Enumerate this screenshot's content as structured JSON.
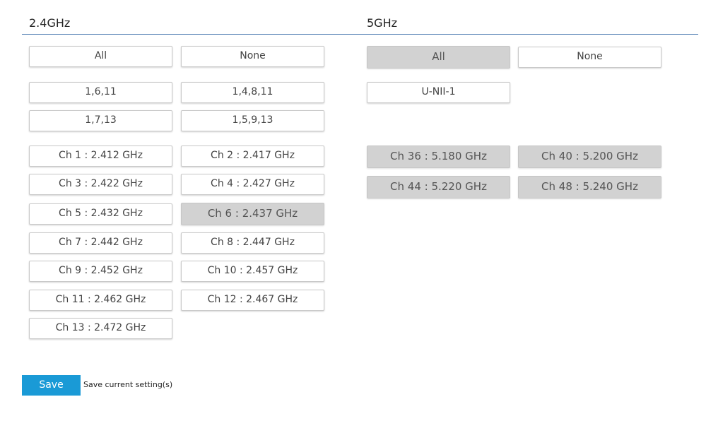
{
  "band_24": {
    "title": "2.4GHz",
    "all_label": "All",
    "none_label": "None",
    "presets": [
      "1,6,11",
      "1,4,8,11",
      "1,7,13",
      "1,5,9,13"
    ],
    "channels": [
      {
        "label": "Ch 1 : 2.412 GHz",
        "selected": false
      },
      {
        "label": "Ch 2 : 2.417 GHz",
        "selected": false
      },
      {
        "label": "Ch 3 : 2.422 GHz",
        "selected": false
      },
      {
        "label": "Ch 4 : 2.427 GHz",
        "selected": false
      },
      {
        "label": "Ch 5 : 2.432 GHz",
        "selected": false
      },
      {
        "label": "Ch 6 : 2.437 GHz",
        "selected": true
      },
      {
        "label": "Ch 7 : 2.442 GHz",
        "selected": false
      },
      {
        "label": "Ch 8 : 2.447 GHz",
        "selected": false
      },
      {
        "label": "Ch 9 : 2.452 GHz",
        "selected": false
      },
      {
        "label": "Ch 10 : 2.457 GHz",
        "selected": false
      },
      {
        "label": "Ch 11 : 2.462 GHz",
        "selected": false
      },
      {
        "label": "Ch 12 : 2.467 GHz",
        "selected": false
      },
      {
        "label": "Ch 13 : 2.472 GHz",
        "selected": false
      }
    ]
  },
  "band_5": {
    "title": "5GHz",
    "all_label": "All",
    "all_selected": true,
    "none_label": "None",
    "presets": [
      "U-NII-1"
    ],
    "channels": [
      {
        "label": "Ch 36 : 5.180 GHz",
        "selected": true
      },
      {
        "label": "Ch 40 : 5.200 GHz",
        "selected": true
      },
      {
        "label": "Ch 44 : 5.220 GHz",
        "selected": true
      },
      {
        "label": "Ch 48 : 5.240 GHz",
        "selected": true
      }
    ]
  },
  "footer": {
    "save_label": "Save",
    "save_note": "Save current setting(s)"
  },
  "colors": {
    "rule": "#4a79b0",
    "save_button": "#1a9ad6",
    "selected_fill": "#d2d2d2"
  }
}
